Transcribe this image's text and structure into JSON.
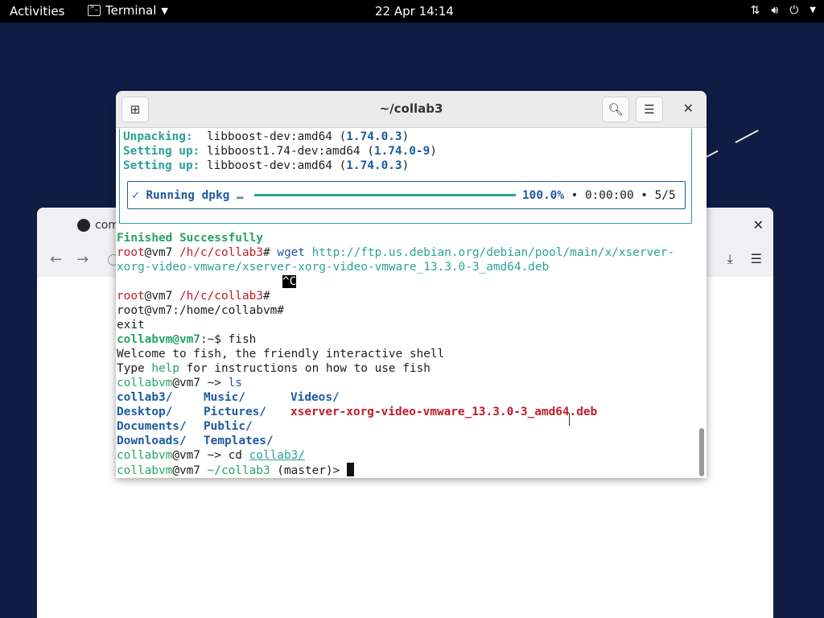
{
  "topbar": {
    "activities": "Activities",
    "app_name": "Terminal",
    "clock": "22 Apr  14:14"
  },
  "browser": {
    "tab_title": "com"
  },
  "terminal": {
    "title": "~/collab3",
    "lines": {
      "l1_label": "Unpacking: ",
      "l1_pkg": " libboost-dev:amd64 (",
      "l1_ver": "1.74.0.3",
      "l1_end": ")",
      "l2_label": "Setting up:",
      "l2_pkg": " libboost1.74-dev:amd64 (",
      "l2_ver": "1.74.0-9",
      "l2_end": ")",
      "l3_label": "Setting up:",
      "l3_pkg": " libboost-dev:amd64 (",
      "l3_ver": "1.74.0.3",
      "l3_end": ")",
      "progress_label": "✓ Running dpkg …",
      "progress_pct": "100.0%",
      "progress_rest": " • 0:00:00 • 5/5",
      "finished": "Finished Successfully",
      "p1_user": "root",
      "p1_host": "@vm7 ",
      "p1_path": "/h/c/collab3",
      "p1_hash": "# ",
      "p1_cmd": "wget",
      "p1_url1": " http://ftp.us.debian.org/debian/pool/main/x/xserver-",
      "p1_url2": "xorg-video-vmware/xserver-xorg-video-vmware_13.3.0-3_amd64.deb",
      "ctrl_c": "^C",
      "p2_user": "root",
      "p2_host": "@vm7 ",
      "p2_path": "/h/c/collab3",
      "p2_hash": "#",
      "home_prompt": "root@vm7:/home/collabvm#",
      "exit": "exit",
      "p3_user": "collabvm@vm7",
      "p3_rest": ":~$ fish",
      "welcome": "Welcome to fish, the friendly interactive shell",
      "type_a": "Type ",
      "type_help": "help",
      "type_b": " for instructions on how to use fish",
      "p4_user": "collabvm",
      "p4_host": "@vm7 ~> ",
      "p4_cmd": "ls",
      "ls_col1": [
        "collab3/",
        "Desktop/",
        "Documents/",
        "Downloads/"
      ],
      "ls_col2": [
        "Music/",
        "Pictures/",
        "Public/",
        "Templates/"
      ],
      "ls_col3_dir": "Videos/",
      "ls_col3_file": "xserver-xorg-video-vmware_13.3.0-3_amd64.deb",
      "p5_user": "collabvm",
      "p5_host": "@vm7 ~> ",
      "p5_cmd": "cd ",
      "p5_arg": "collab3/",
      "p6_user": "collabvm",
      "p6_host": "@vm7 ",
      "p6_path": "~/collab3",
      "p6_branch": " (master)> "
    }
  }
}
